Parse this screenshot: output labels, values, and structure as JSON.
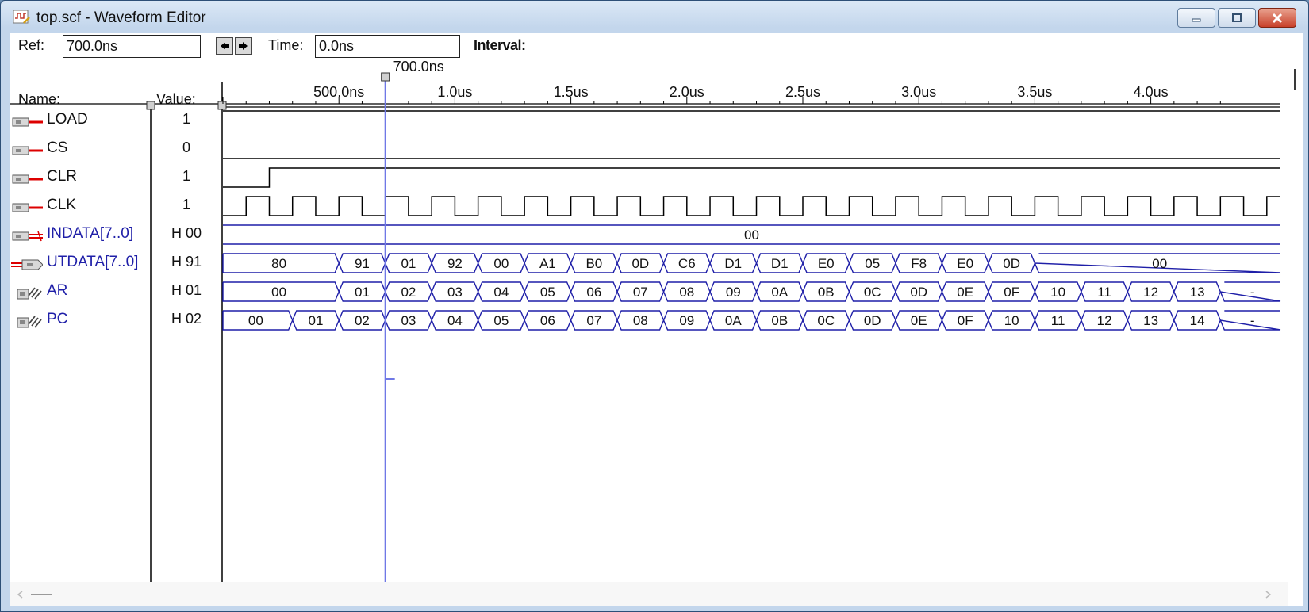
{
  "window": {
    "title": "top.scf - Waveform Editor"
  },
  "toolbar": {
    "ref_label": "Ref:",
    "ref_value": "700.0ns",
    "time_label": "Time:",
    "time_value": "0.0ns",
    "interval_label": "Interval:",
    "interval_value": ""
  },
  "header": {
    "name_label": "Name:",
    "value_label": "Value:",
    "cursor_label": "700.0ns"
  },
  "timeline": {
    "unit": "ns",
    "cursor_time": 700,
    "ticks": [
      {
        "label": "500.0ns",
        "time": 500
      },
      {
        "label": "1.0us",
        "time": 1000
      },
      {
        "label": "1.5us",
        "time": 1500
      },
      {
        "label": "2.0us",
        "time": 2000
      },
      {
        "label": "2.5us",
        "time": 2500
      },
      {
        "label": "3.0us",
        "time": 3000
      },
      {
        "label": "3.5us",
        "time": 3500
      },
      {
        "label": "4.0us",
        "time": 4000
      }
    ]
  },
  "signals": [
    {
      "name": "LOAD",
      "value": "1",
      "icon": "input-pin-icon",
      "kind": "bit",
      "initial": 1,
      "transitions": []
    },
    {
      "name": "CS",
      "value": "0",
      "icon": "input-pin-icon",
      "kind": "bit",
      "initial": 0,
      "transitions": []
    },
    {
      "name": "CLR",
      "value": "1",
      "icon": "input-pin-icon",
      "kind": "bit",
      "initial": 0,
      "transitions": [
        200
      ]
    },
    {
      "name": "CLK",
      "value": "1",
      "icon": "input-pin-icon",
      "kind": "clock",
      "first_edge": 100,
      "half_period": 100
    },
    {
      "name": "INDATA[7..0]",
      "value": "H 00",
      "icon": "input-bus-icon",
      "kind": "bus-flat",
      "label": "00"
    },
    {
      "name": "UTDATA[7..0]",
      "value": "H 91",
      "icon": "output-bus-icon",
      "kind": "bus",
      "segments": [
        {
          "v": "80",
          "t": 0
        },
        {
          "v": "91",
          "t": 500
        },
        {
          "v": "01",
          "t": 700
        },
        {
          "v": "92",
          "t": 900
        },
        {
          "v": "00",
          "t": 1100
        },
        {
          "v": "A1",
          "t": 1300
        },
        {
          "v": "B0",
          "t": 1500
        },
        {
          "v": "0D",
          "t": 1700
        },
        {
          "v": "C6",
          "t": 1900
        },
        {
          "v": "D1",
          "t": 2100
        },
        {
          "v": "D1",
          "t": 2300
        },
        {
          "v": "E0",
          "t": 2500
        },
        {
          "v": "05",
          "t": 2700
        },
        {
          "v": "F8",
          "t": 2900
        },
        {
          "v": "E0",
          "t": 3100
        },
        {
          "v": "0D",
          "t": 3300
        },
        {
          "v": "00",
          "t": 3500
        }
      ]
    },
    {
      "name": "AR",
      "value": "H 01",
      "icon": "buried-node-icon",
      "kind": "bus",
      "segments": [
        {
          "v": "00",
          "t": 0
        },
        {
          "v": "01",
          "t": 500
        },
        {
          "v": "02",
          "t": 700
        },
        {
          "v": "03",
          "t": 900
        },
        {
          "v": "04",
          "t": 1100
        },
        {
          "v": "05",
          "t": 1300
        },
        {
          "v": "06",
          "t": 1500
        },
        {
          "v": "07",
          "t": 1700
        },
        {
          "v": "08",
          "t": 1900
        },
        {
          "v": "09",
          "t": 2100
        },
        {
          "v": "0A",
          "t": 2300
        },
        {
          "v": "0B",
          "t": 2500
        },
        {
          "v": "0C",
          "t": 2700
        },
        {
          "v": "0D",
          "t": 2900
        },
        {
          "v": "0E",
          "t": 3100
        },
        {
          "v": "0F",
          "t": 3300
        },
        {
          "v": "10",
          "t": 3500
        },
        {
          "v": "11",
          "t": 3700
        },
        {
          "v": "12",
          "t": 3900
        },
        {
          "v": "13",
          "t": 4100
        },
        {
          "v": "-",
          "t": 4300
        }
      ]
    },
    {
      "name": "PC",
      "value": "H 02",
      "icon": "buried-node-icon",
      "kind": "bus",
      "segments": [
        {
          "v": "00",
          "t": 0
        },
        {
          "v": "01",
          "t": 300
        },
        {
          "v": "02",
          "t": 500
        },
        {
          "v": "03",
          "t": 700
        },
        {
          "v": "04",
          "t": 900
        },
        {
          "v": "05",
          "t": 1100
        },
        {
          "v": "06",
          "t": 1300
        },
        {
          "v": "07",
          "t": 1500
        },
        {
          "v": "08",
          "t": 1700
        },
        {
          "v": "09",
          "t": 1900
        },
        {
          "v": "0A",
          "t": 2100
        },
        {
          "v": "0B",
          "t": 2300
        },
        {
          "v": "0C",
          "t": 2500
        },
        {
          "v": "0D",
          "t": 2700
        },
        {
          "v": "0E",
          "t": 2900
        },
        {
          "v": "0F",
          "t": 3100
        },
        {
          "v": "10",
          "t": 3300
        },
        {
          "v": "11",
          "t": 3500
        },
        {
          "v": "12",
          "t": 3700
        },
        {
          "v": "13",
          "t": 3900
        },
        {
          "v": "14",
          "t": 4100
        },
        {
          "v": "-",
          "t": 4300
        }
      ]
    }
  ],
  "colors": {
    "bus": "#1f1fa8",
    "wave": "#000000",
    "cursor": "#6f78e6",
    "background": "#ffffff"
  }
}
